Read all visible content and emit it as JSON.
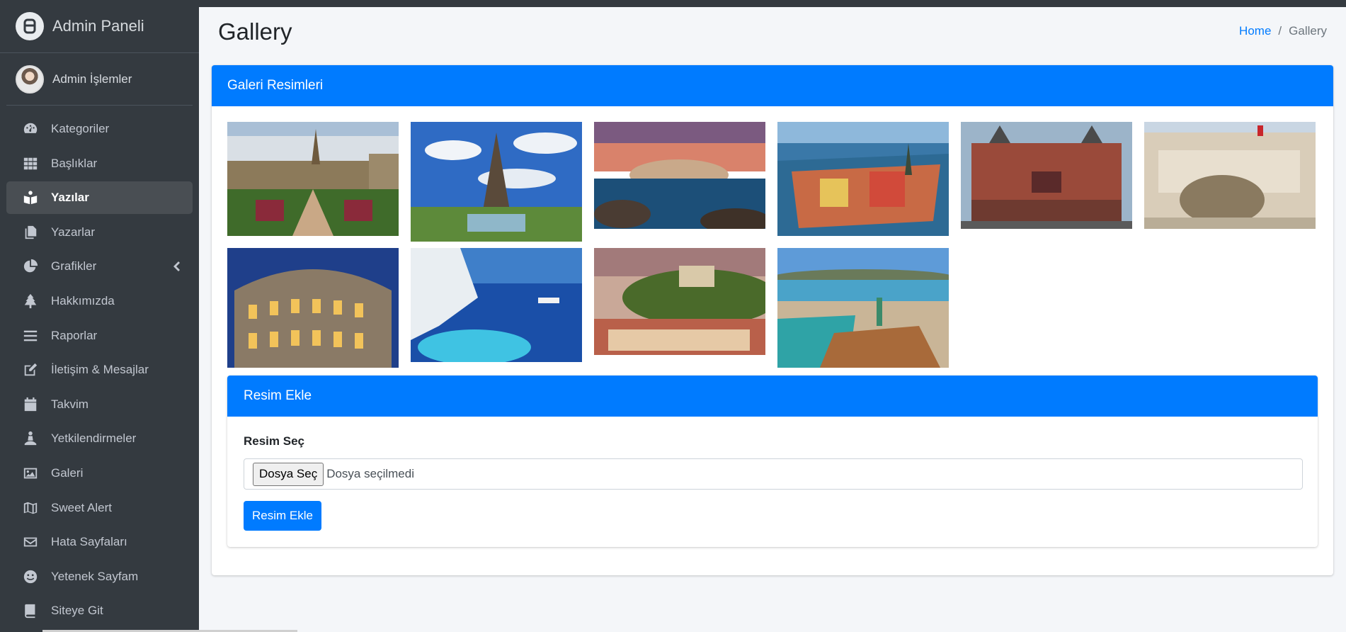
{
  "sidebar": {
    "brand": "Admin Paneli",
    "user": "Admin İşlemler",
    "items": [
      {
        "label": "Kategoriler",
        "icon": "tachometer-icon"
      },
      {
        "label": "Başlıklar",
        "icon": "grid-icon"
      },
      {
        "label": "Yazılar",
        "icon": "book-reader-icon"
      },
      {
        "label": "Yazarlar",
        "icon": "copy-icon"
      },
      {
        "label": "Grafikler",
        "icon": "pie-chart-icon"
      },
      {
        "label": "Hakkımızda",
        "icon": "tree-icon"
      },
      {
        "label": "Raporlar",
        "icon": "bars-icon"
      },
      {
        "label": "İletişim & Mesajlar",
        "icon": "edit-icon"
      },
      {
        "label": "Takvim",
        "icon": "calendar-icon"
      },
      {
        "label": "Yetkilendirmeler",
        "icon": "meditation-icon"
      },
      {
        "label": "Galeri",
        "icon": "image-icon"
      },
      {
        "label": "Sweet Alert",
        "icon": "map-icon"
      },
      {
        "label": "Hata Sayfaları",
        "icon": "envelope-icon"
      },
      {
        "label": "Yetenek Sayfam",
        "icon": "smile-icon"
      },
      {
        "label": "Siteye Git",
        "icon": "book-icon"
      }
    ]
  },
  "header": {
    "title": "Gallery",
    "breadcrumb_home": "Home",
    "breadcrumb_sep": "/",
    "breadcrumb_current": "Gallery"
  },
  "gallery": {
    "title": "Galeri Resimleri",
    "images": [
      "brussels",
      "paris-eiffel",
      "coastal-town",
      "stockholm",
      "amsterdam-station",
      "madrid-cibeles",
      "rome-colosseum",
      "santorini",
      "salzburg",
      "zurich"
    ]
  },
  "upload": {
    "title": "Resim Ekle",
    "label": "Resim Seç",
    "file_button": "Dosya Seç",
    "file_status": "Dosya seçilmedi",
    "submit": "Resim Ekle"
  },
  "colors": {
    "sidebar_bg": "#343a40",
    "primary": "#007bff",
    "page_bg": "#f4f6f9"
  }
}
